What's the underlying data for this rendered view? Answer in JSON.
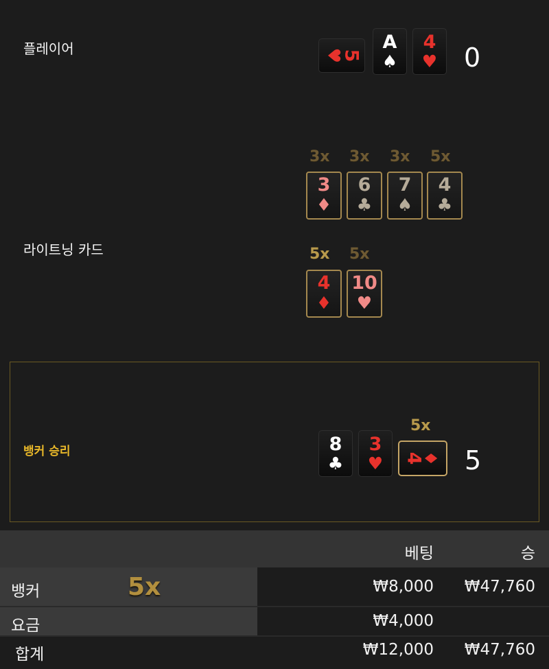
{
  "player": {
    "label": "플레이어",
    "score": "0",
    "cards": [
      {
        "rank": "5",
        "suit": "♥",
        "color": "red",
        "rotated": true
      },
      {
        "rank": "A",
        "suit": "♠",
        "color": "white"
      },
      {
        "rank": "4",
        "suit": "♥",
        "color": "red"
      }
    ]
  },
  "lightning": {
    "label": "라이트닝 카드",
    "row1": [
      {
        "mult": "3x",
        "rank": "3",
        "suit": "♦",
        "color": "pink"
      },
      {
        "mult": "3x",
        "rank": "6",
        "suit": "♣",
        "color": "grey"
      },
      {
        "mult": "3x",
        "rank": "7",
        "suit": "♠",
        "color": "grey"
      },
      {
        "mult": "5x",
        "rank": "4",
        "suit": "♣",
        "color": "grey"
      }
    ],
    "row2": [
      {
        "mult": "5x",
        "rank": "4",
        "suit": "♦",
        "color": "red"
      },
      {
        "mult": "5x",
        "rank": "10",
        "suit": "♥",
        "color": "pink"
      }
    ]
  },
  "banker": {
    "win_label": "뱅커 승리",
    "score": "5",
    "cards": [
      {
        "rank": "8",
        "suit": "♣",
        "color": "white"
      },
      {
        "rank": "3",
        "suit": "♥",
        "color": "red"
      },
      {
        "rank": "4",
        "suit": "♦",
        "color": "red",
        "rotated": true,
        "mult": "5x"
      }
    ]
  },
  "table": {
    "headers": {
      "bet": "베팅",
      "win": "승"
    },
    "rows": [
      {
        "name": "뱅커",
        "multiplier": "5x",
        "bet": "₩8,000",
        "win": "₩47,760"
      },
      {
        "name": "요금",
        "bet": "₩4,000",
        "win": ""
      }
    ],
    "total": {
      "name": "합계",
      "bet": "₩12,000",
      "win": "₩47,760"
    }
  },
  "colors": {
    "background": "#1c1c1c",
    "gold": "#c6a666",
    "banker_win": "#e9b829",
    "card_red": "#e8322c"
  }
}
